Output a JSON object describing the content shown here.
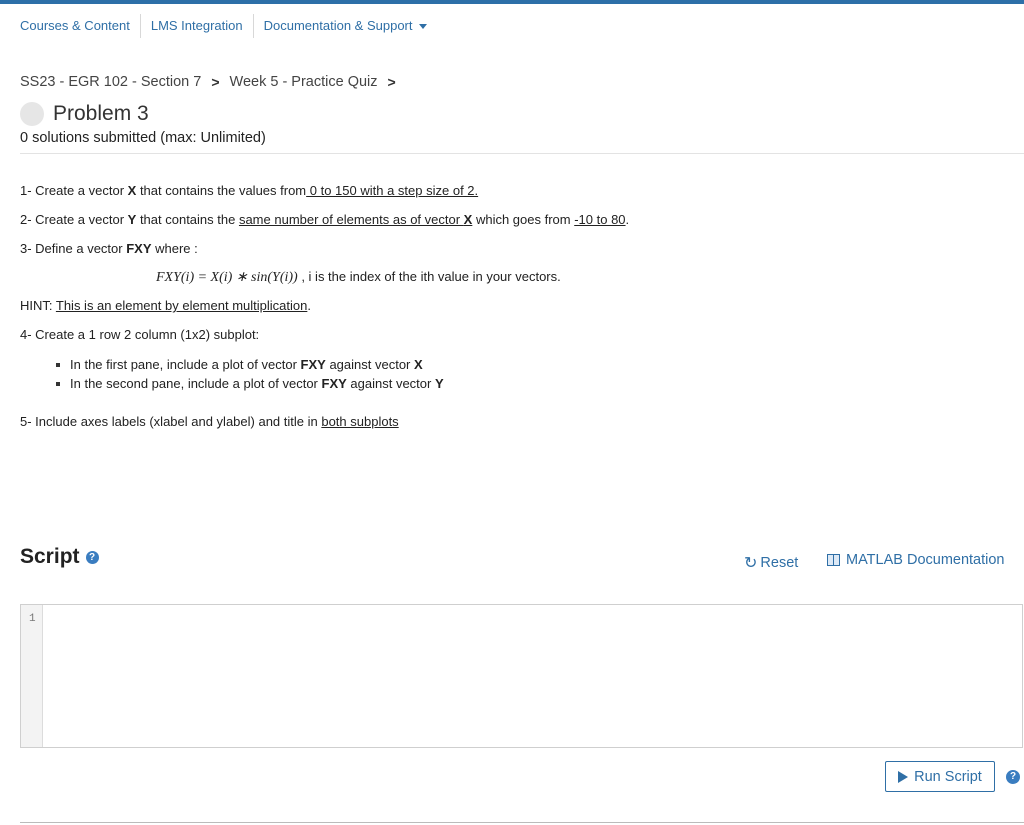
{
  "nav": {
    "items": [
      "Courses & Content",
      "LMS Integration",
      "Documentation & Support"
    ]
  },
  "breadcrumb": [
    "SS23 - EGR 102 - Section 7",
    "Week 5 - Practice Quiz"
  ],
  "problem": {
    "title": "Problem 3",
    "submitted": "0 solutions submitted (max: Unlimited)"
  },
  "instructions": {
    "l1": {
      "a": "1- Create a vector ",
      "b": "X",
      "c": " that contains the values from",
      "d": " 0 to 150 with a step size of 2."
    },
    "l2": {
      "a": "2- Create a vector ",
      "b": "Y",
      "c": " that contains the ",
      "d": "same number of elements as of vector ",
      "e": "X",
      "f": " which goes from ",
      "g": "-10 to 80",
      "h": "."
    },
    "l3": {
      "a": "3- Define a vector ",
      "b": "FXY",
      "c": " where :"
    },
    "formula": {
      "math": "FXY(i) = X(i) ∗ sin(Y(i))",
      "text": " , i is the index of the ith value in your vectors."
    },
    "hint": {
      "a": "HINT: ",
      "b": "This is an element by element multiplication",
      "c": "."
    },
    "l4": "4- Create a 1 row 2 column (1x2) subplot:",
    "bullet1": {
      "a": "In the first pane, include a plot of vector ",
      "b": "FXY",
      "c": " against vector ",
      "d": "X"
    },
    "bullet2": {
      "a": "In the second pane, include a plot of vector ",
      "b": "FXY",
      "c": " against vector ",
      "d": "Y"
    },
    "l5": {
      "a": "5- Include axes labels (xlabel and ylabel) and title in ",
      "b": "both subplots"
    }
  },
  "script": {
    "title": "Script",
    "reset_label": "Reset",
    "doc_label": "MATLAB Documentation",
    "line_number": "1",
    "run_label": "Run Script"
  },
  "icons": {
    "help": "question-circle-icon",
    "reset": "rotate-icon",
    "doc": "book-icon",
    "run": "play-icon"
  },
  "colors": {
    "accent": "#2f6fa6",
    "topbar": "#2d6fa8"
  }
}
